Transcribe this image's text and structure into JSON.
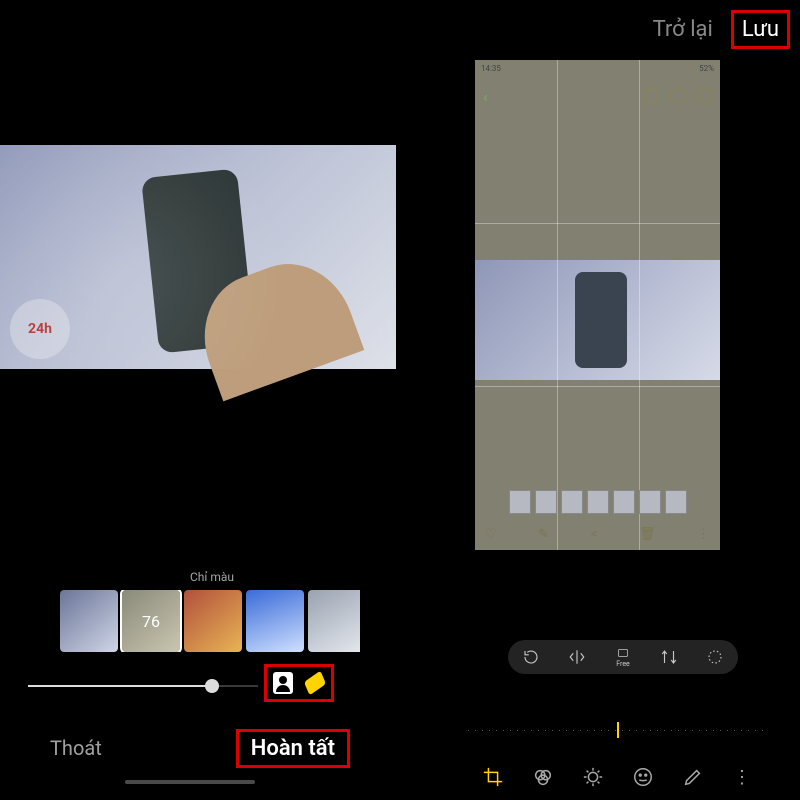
{
  "topbar": {
    "back": "Trở lại",
    "save": "Lưu"
  },
  "left_preview": {
    "watermark": "24h"
  },
  "right_phone": {
    "status_left": "14:35",
    "status_right": "52%",
    "bottom_icons": [
      "♡",
      "✎",
      "<",
      "🗑",
      "⋮"
    ]
  },
  "crop_tools": {
    "rotate": "rotate-icon",
    "flip": "flip-icon",
    "free_label": "Free",
    "transform": "transform-icon",
    "expand": "expand-icon"
  },
  "style": {
    "label": "Chỉ màu",
    "selected_intensity": "76"
  },
  "slider": {
    "value_pct": 80
  },
  "bottom": {
    "exit": "Thoát",
    "done": "Hoàn tất"
  }
}
